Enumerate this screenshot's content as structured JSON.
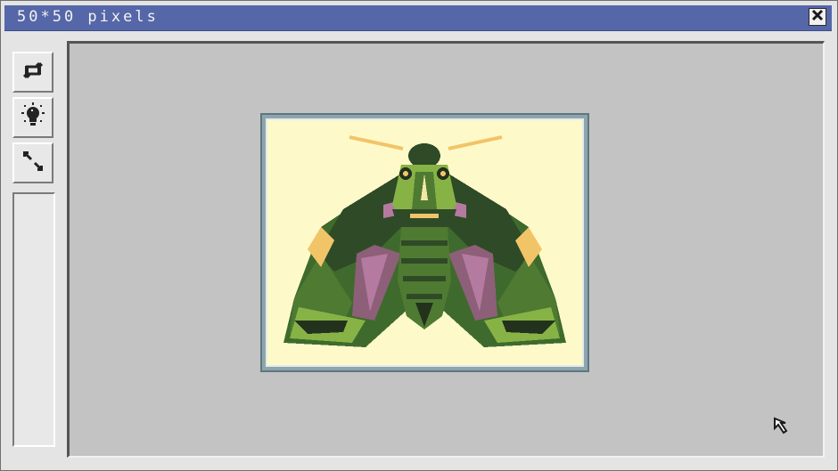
{
  "window": {
    "title": "50*50 pixels"
  },
  "titlebar": {
    "close_icon": "close-icon"
  },
  "toolbar": {
    "tools": [
      {
        "name": "refresh-icon"
      },
      {
        "name": "lightbulb-icon"
      },
      {
        "name": "resize-icon"
      }
    ]
  },
  "canvas": {
    "image_subject": "pixel-art-moth",
    "colors": {
      "background": "#fef9c9",
      "frame": "#8fa5ad",
      "green_dark": "#2f4a27",
      "green_mid": "#4f7a32",
      "green_light": "#87b346",
      "pink": "#b57aa0",
      "orange": "#f2c468"
    }
  }
}
